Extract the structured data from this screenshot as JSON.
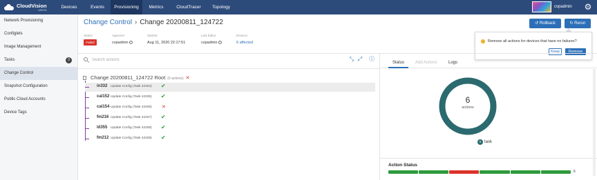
{
  "app": {
    "logo_text": "CloudVision",
    "logo_sub": "ARISTA",
    "nav_tabs": [
      "Devices",
      "Events",
      "Provisioning",
      "Metrics",
      "CloudTracer",
      "Topology"
    ],
    "active_tab": "Provisioning",
    "user_name": "cvpadmin",
    "icons": {
      "settings": "gear-icon",
      "avatar": "user-avatar-icon"
    }
  },
  "sidebar": {
    "items": [
      {
        "label": "Network Provisioning"
      },
      {
        "label": "Configlets"
      },
      {
        "label": "Image Management"
      },
      {
        "label": "Tasks",
        "badge": "3"
      },
      {
        "label": "Change Control",
        "active": true
      },
      {
        "label": "Snapshot Configuration"
      },
      {
        "label": "Public Cloud Accounts"
      },
      {
        "label": "Device Tags"
      }
    ]
  },
  "header": {
    "breadcrumb_link": "Change Control",
    "breadcrumb_sep": "›",
    "title": "Change 20200811_124722",
    "status_label": "Status",
    "status_value": "Failed",
    "approver_label": "Approver",
    "approver_value": "cvpadmin",
    "started_label": "Started",
    "started_value": "Aug 11, 2020 22:17:51",
    "editor_label": "Last Editor",
    "editor_value": "cvpadmin",
    "devices_label": "Devices",
    "devices_value": "6 affected",
    "rollback_label": "Rollback",
    "rerun_label": "Rerun"
  },
  "popover": {
    "message": "Remove all actions for devices that have no failures?",
    "keep_label": "Keep",
    "remove_label": "Remove",
    "warn_icon": "warning-icon",
    "warn_color": "#f0a81c"
  },
  "search": {
    "placeholder": "Search actions"
  },
  "tree": {
    "root_label": "Change 20200811_124722 Root",
    "root_count": "(6 actions)",
    "rows": [
      {
        "device": "in332",
        "desc": "Update Config (Task 42334)",
        "status": "success",
        "highlight": true
      },
      {
        "device": "cal152",
        "desc": "Update Config (Task 42335)",
        "status": "success"
      },
      {
        "device": "cal154",
        "desc": "Update Config (Task 42336)",
        "status": "failed"
      },
      {
        "device": "fm216",
        "desc": "Update Config (Task 42337)",
        "status": "success"
      },
      {
        "device": "ld355",
        "desc": "Update Config (Task 42338)",
        "status": "success"
      },
      {
        "device": "fm212",
        "desc": "Update Config (Task 42339)",
        "status": "success"
      }
    ]
  },
  "right_panel": {
    "tabs": [
      "Status",
      "Add Actions",
      "Logs"
    ],
    "active_tab": "Status",
    "donut_value": "6",
    "donut_label": "actions",
    "legend_count": "6",
    "legend_label": "task",
    "ring_color": "#2b6a6e",
    "action_status_title": "Action Status",
    "action_status_count": "6",
    "segments": [
      "success",
      "success",
      "failed",
      "success",
      "success",
      "success"
    ]
  },
  "colors": {
    "nav_bg": "#2c4a7a",
    "accent": "#2c6fb7",
    "success": "#2e9b3c",
    "failed": "#d9342b",
    "tree_line": "#7c3fa0"
  }
}
